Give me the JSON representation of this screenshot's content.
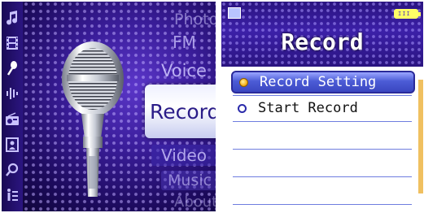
{
  "left_panel": {
    "menu": {
      "photo": "Photo",
      "fm": "FM",
      "voice": "Voice",
      "record": "Record",
      "video": "Video",
      "music": "Music",
      "about": "About"
    },
    "side_icons": [
      "music-note-icon",
      "film-icon",
      "microphone-icon",
      "sound-wave-icon",
      "radio-icon",
      "photo-frame-icon",
      "search-icon",
      "info-icon"
    ]
  },
  "right_panel": {
    "title": "Record",
    "items": [
      {
        "label": "Record Setting",
        "selected": true
      },
      {
        "label": "Start Record",
        "selected": false
      }
    ],
    "battery_glyph": "III"
  },
  "colors": {
    "background_purple": "#3a1d9a",
    "highlight_blue": "#4c5cd6",
    "bullet_orange": "#f4b01a",
    "battery_yellow": "#ffff66"
  }
}
